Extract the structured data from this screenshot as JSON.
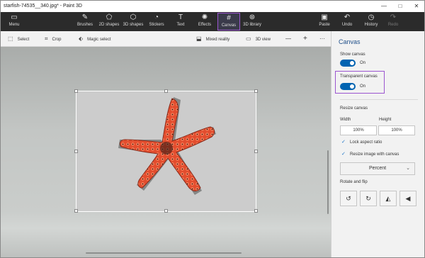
{
  "title": "starfish-74535__340.jpg* - Paint 3D",
  "window_buttons": {
    "minimize": "—",
    "maximize": "□",
    "close": "✕"
  },
  "ribbon": {
    "menu": "Menu",
    "brushes": "Brushes",
    "shapes2d": "2D shapes",
    "shapes3d": "3D shapes",
    "stickers": "Stickers",
    "text": "Text",
    "effects": "Effects",
    "canvas": "Canvas",
    "library3d": "3D library",
    "paste": "Paste",
    "undo": "Undo",
    "history": "History",
    "redo": "Redo"
  },
  "toolbar": {
    "select": "Select",
    "crop": "Crop",
    "magic_select": "Magic select",
    "mixed_reality": "Mixed reality",
    "view3d": "3D view",
    "zoom_out": "—",
    "zoom_in": "+",
    "more": "···"
  },
  "panel": {
    "title": "Canvas",
    "show_canvas": "Show canvas",
    "show_canvas_state": "On",
    "transparent_canvas": "Transparent canvas",
    "transparent_state": "On",
    "resize_canvas": "Resize canvas",
    "width_label": "Width",
    "height_label": "Height",
    "width_value": "100%",
    "height_value": "100%",
    "lock_aspect": "Lock aspect ratio",
    "resize_with_canvas": "Resize image with canvas",
    "unit": "Percent",
    "rotate_flip": "Rotate and flip"
  },
  "colors": {
    "accent": "#0063b1",
    "highlight": "#9b55d0",
    "ribbon_bg": "#2b2b2b"
  }
}
